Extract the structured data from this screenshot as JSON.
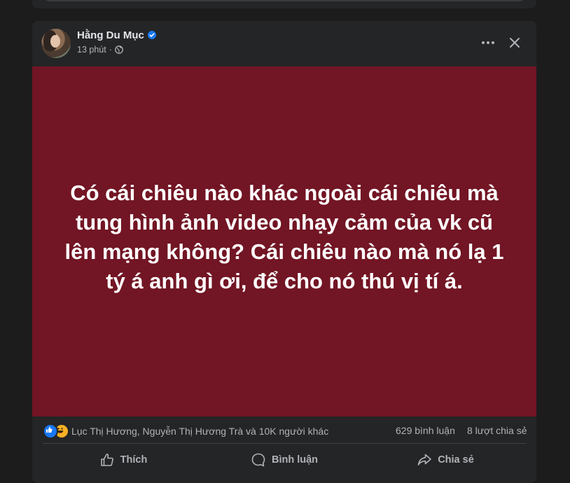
{
  "post": {
    "author": "Hằng Du Mục",
    "time": "13 phút",
    "separator": "·",
    "text": "Có cái chiêu nào khác ngoài cái chiêu mà tung hình ảnh video nhạy cảm của vk cũ lên mạng không? Cái chiêu nào mà nó lạ 1 tý á anh gì ơi, để cho nó thú vị tí á.",
    "background_color": "#721524"
  },
  "stats": {
    "reactions_text": "Lục Thị Hương, Nguyễn Thị Hương Trà và 10K người khác",
    "reaction_icons": [
      "like-icon",
      "haha-icon"
    ],
    "comments": "629 bình luận",
    "shares": "8 lượt chia sẻ"
  },
  "actions": {
    "like_label": "Thích",
    "comment_label": "Bình luận",
    "share_label": "Chia sẻ"
  },
  "colors": {
    "accent": "#1877f2",
    "card": "#242526",
    "page_bg": "#1c1c1d"
  }
}
